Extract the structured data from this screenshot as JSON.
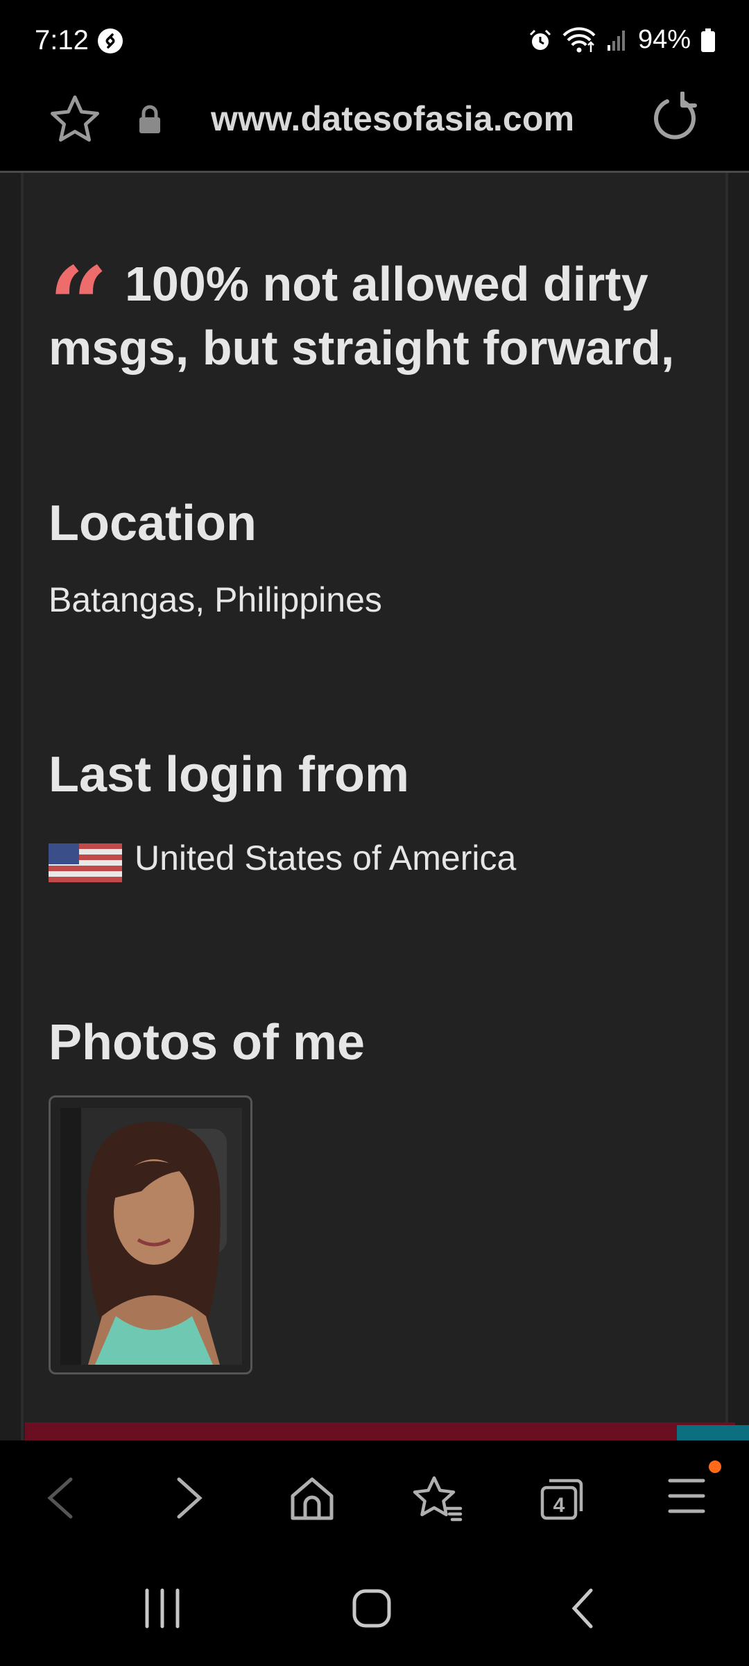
{
  "status_bar": {
    "time": "7:12",
    "battery": "94%"
  },
  "browser": {
    "url": "www.datesofasia.com",
    "tab_count": "4"
  },
  "profile": {
    "quote": "100% not allowed dirty msgs, but straight forward,",
    "location_title": "Location",
    "location_value": "Batangas, Philippines",
    "last_login_title": "Last login from",
    "last_login_value": "United States of America",
    "photos_title": "Photos of me"
  },
  "colors": {
    "accent_quote": "#ef6c6c",
    "background": "#222222",
    "notification_dot": "#ff6a1a"
  },
  "icons": [
    "shazam-icon",
    "alarm-icon",
    "wifi-icon",
    "signal-icon",
    "battery-icon",
    "star-icon",
    "lock-icon",
    "reload-icon",
    "back-icon",
    "forward-icon",
    "home-icon",
    "bookmarks-icon",
    "tabs-icon",
    "menu-icon",
    "recents-icon",
    "home-nav-icon",
    "back-nav-icon"
  ]
}
